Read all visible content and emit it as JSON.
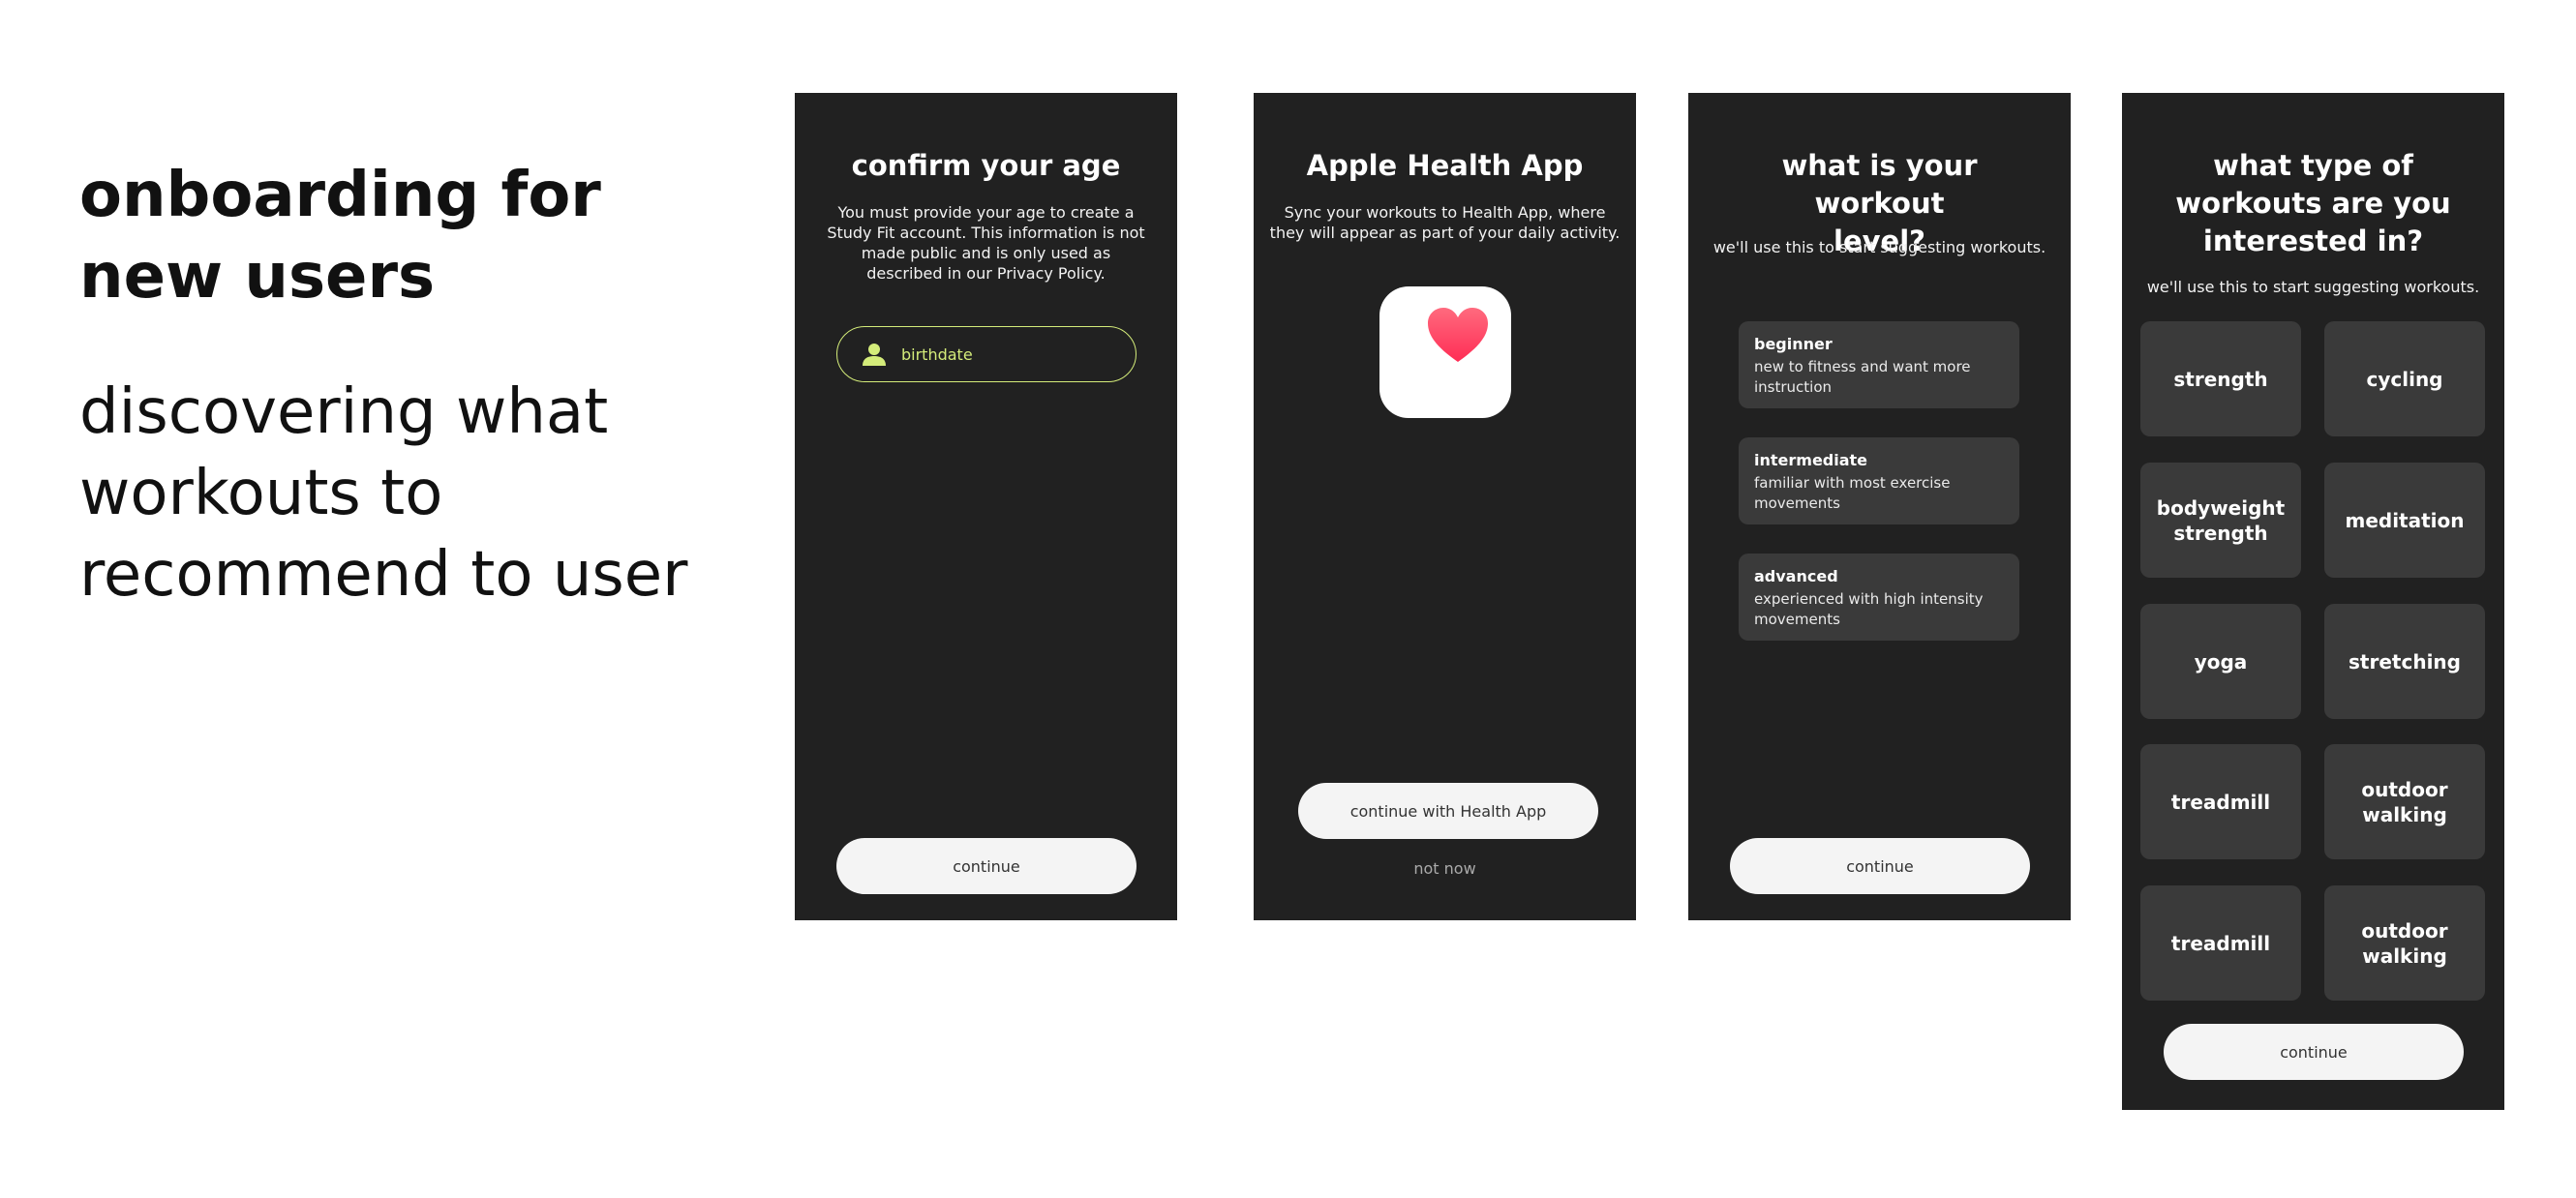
{
  "intro": {
    "heading": "onboarding for new users",
    "subheading": "discovering what workouts to recommend to user"
  },
  "screen_age": {
    "title": "confirm your age",
    "description": "You must provide your age to create a Study Fit account. This information is not made public and is only used as described in our Privacy Policy.",
    "birthdate_placeholder": "birthdate",
    "user_icon": "user-icon",
    "continue_label": "continue"
  },
  "screen_health": {
    "title": "Apple Health App",
    "description": "Sync your workouts to Health App, where they will appear as part of your daily activity.",
    "app_icon": "heart-icon",
    "continue_label": "continue with Health App",
    "not_now_label": "not now"
  },
  "screen_level": {
    "title": "what is your workout level?",
    "description": "we'll use this to start suggesting workouts.",
    "levels": [
      {
        "name": "beginner",
        "desc": "new to fitness and want more instruction"
      },
      {
        "name": "intermediate",
        "desc": "familiar with most exercise movements"
      },
      {
        "name": "advanced",
        "desc": "experienced with high intensity movements"
      }
    ],
    "continue_label": "continue"
  },
  "screen_types": {
    "title": "what type of workouts are you interested in?",
    "description": "we'll use this to start suggesting workouts.",
    "types": [
      "strength",
      "cycling",
      "bodyweight strength",
      "meditation",
      "yoga",
      "stretching",
      "treadmill",
      "outdoor walking",
      "treadmill",
      "outdoor walking"
    ],
    "continue_label": "continue"
  },
  "colors": {
    "screen_bg": "#212121",
    "card_bg": "#3a3a3a",
    "accent": "#d4ec7a",
    "heart": "#ff3b5c",
    "button_bg": "#f4f4f4"
  }
}
